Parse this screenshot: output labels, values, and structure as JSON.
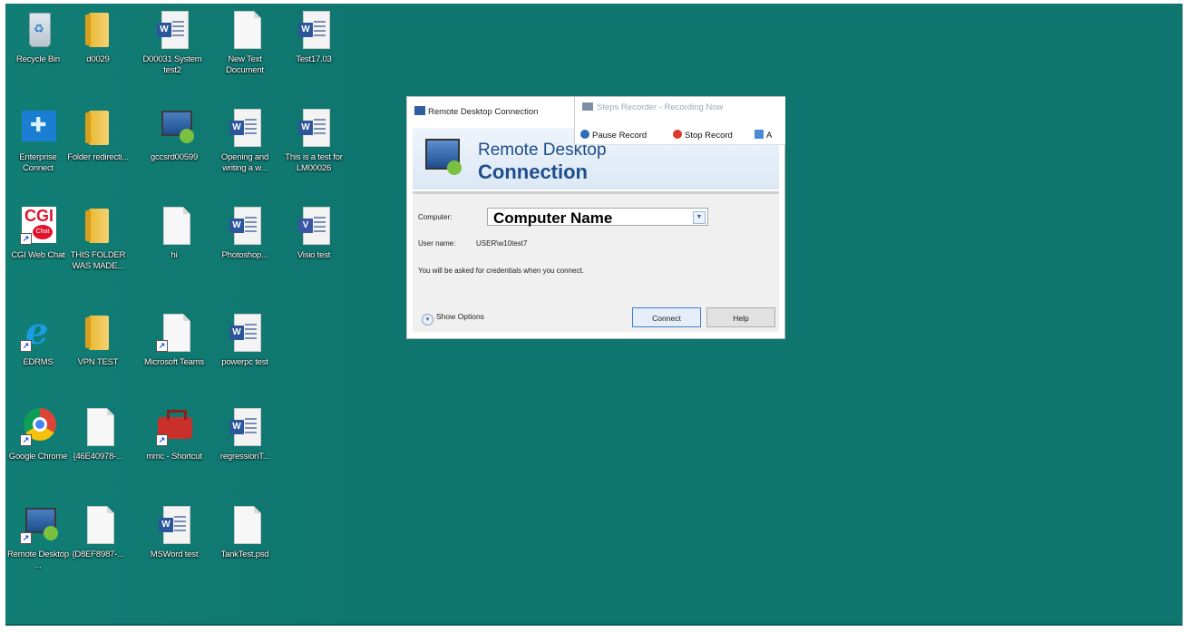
{
  "desktop": {
    "icons": [
      {
        "label": "Recycle Bin"
      },
      {
        "label": "d0029"
      },
      {
        "label": "D00031 System test2"
      },
      {
        "label": "New Text Document"
      },
      {
        "label": "Test17.03"
      },
      {
        "label": "Enterprise Connect"
      },
      {
        "label": "Folder redirecti..."
      },
      {
        "label": "gccsrd00599"
      },
      {
        "label": "Opening and writing a w..."
      },
      {
        "label": "This is a test for LM00026"
      },
      {
        "label": "CGI Web Chat"
      },
      {
        "label": "THIS FOLDER WAS MADE..."
      },
      {
        "label": "hi"
      },
      {
        "label": "Photoshop..."
      },
      {
        "label": "Visio test"
      },
      {
        "label": "EDRMS"
      },
      {
        "label": "VPN TEST"
      },
      {
        "label": "Microsoft Teams"
      },
      {
        "label": "powerpc test"
      },
      {
        "label": "Google Chrome"
      },
      {
        "label": "{46E40978-..."
      },
      {
        "label": "mmc - Shortcut"
      },
      {
        "label": "regressionT..."
      },
      {
        "label": "Remote Desktop ..."
      },
      {
        "label": "{D8EF8987-..."
      },
      {
        "label": "MSWord test"
      },
      {
        "label": "TankTest.psd"
      }
    ]
  },
  "rdp": {
    "window_title": "Remote Desktop Connection",
    "banner_line1": "Remote Desktop",
    "banner_line2": "Connection",
    "computer_label": "Computer:",
    "computer_value": "Computer Name",
    "username_label": "User name:",
    "username_value": "USER\\w10test7",
    "info_text": "You will be asked for credentials when you connect.",
    "show_options": "Show Options",
    "connect": "Connect",
    "help": "Help"
  },
  "steps_recorder": {
    "title": "Steps Recorder - Recording Now",
    "pause": "Pause Record",
    "stop": "Stop Record",
    "add": "A"
  }
}
